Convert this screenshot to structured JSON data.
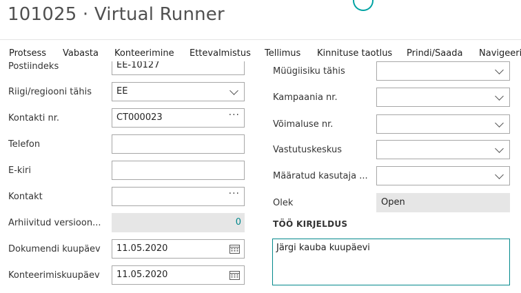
{
  "page": {
    "title": "101025 · Virtual Runner"
  },
  "menu": [
    "Protsess",
    "Vabasta",
    "Konteerimine",
    "Ettevalmistus",
    "Tellimus",
    "Kinnituse taotlus",
    "Prindi/Saada",
    "Navigeeri"
  ],
  "left": {
    "postcode": {
      "label": "Postiindeks",
      "value": "EE-10127"
    },
    "country": {
      "label": "Riigi/regiooni tähis",
      "value": "EE"
    },
    "contact_no": {
      "label": "Kontakti nr.",
      "value": "CT000023"
    },
    "phone": {
      "label": "Telefon",
      "value": ""
    },
    "email": {
      "label": "E-kiri",
      "value": ""
    },
    "contact": {
      "label": "Kontakt",
      "value": ""
    },
    "archived_versions": {
      "label": "Arhiivitud versioon...",
      "value": "0"
    },
    "document_date": {
      "label": "Dokumendi kuupäev",
      "value": "11.05.2020"
    },
    "posting_date": {
      "label": "Konteerimiskuupäev",
      "value": "11.05.2020"
    }
  },
  "right": {
    "salesperson": {
      "label": "Müügiisiku tähis",
      "value": ""
    },
    "campaign": {
      "label": "Kampaania nr.",
      "value": ""
    },
    "opportunity": {
      "label": "Võimaluse nr.",
      "value": ""
    },
    "responsibility": {
      "label": "Vastutuskeskus",
      "value": ""
    },
    "assigned_user": {
      "label": "Määratud kasutaja ...",
      "value": ""
    },
    "status": {
      "label": "Olek",
      "value": "Open"
    },
    "work_description": {
      "title": "TÖÖ KIRJELDUS",
      "value": "Järgi kauba kuupäevi"
    }
  },
  "colors": {
    "accent": "#00878a",
    "readonly_bg": "#e6e6e6",
    "border": "#a6a6a6"
  }
}
